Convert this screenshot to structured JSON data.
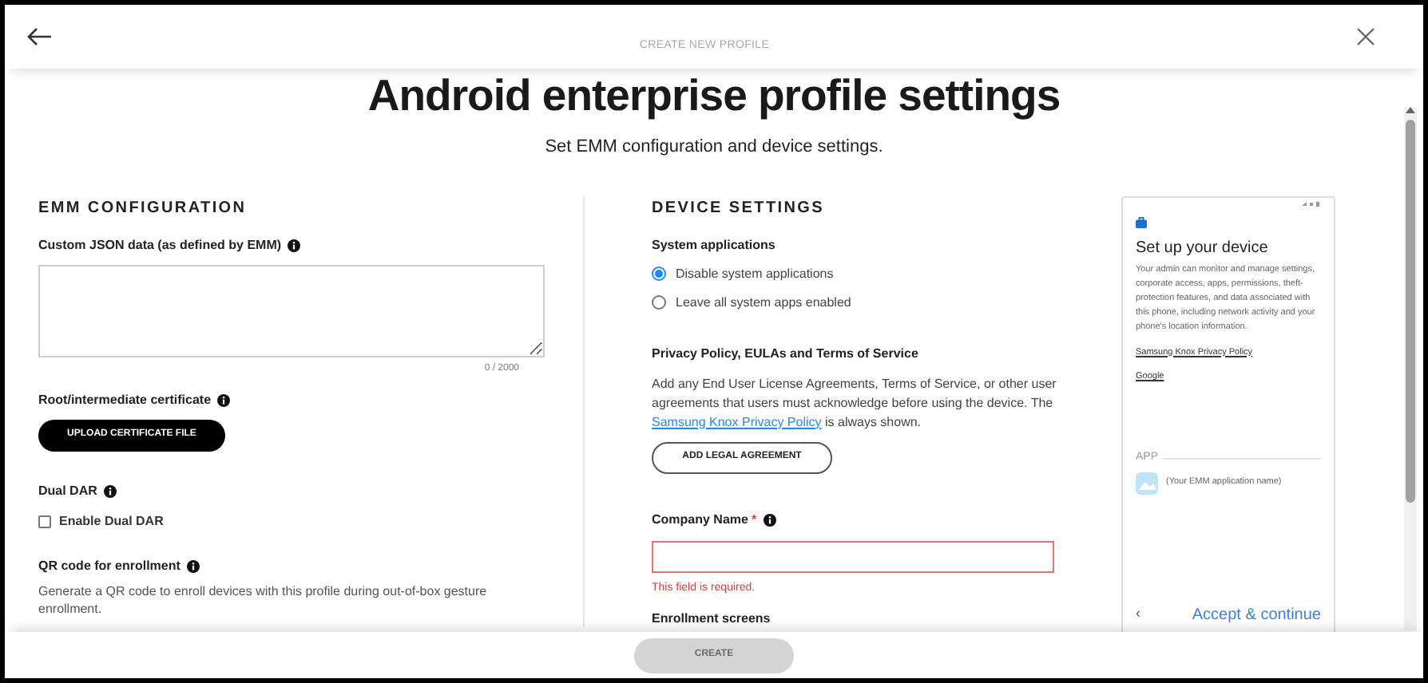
{
  "header": {
    "title": "CREATE NEW PROFILE"
  },
  "page": {
    "title": "Android enterprise profile settings",
    "subtitle": "Set EMM configuration and device settings."
  },
  "emm_configuration": {
    "heading": "EMM CONFIGURATION",
    "custom_json": {
      "label": "Custom JSON data (as defined by EMM)",
      "counter": "0 / 2000"
    },
    "certificate": {
      "label": "Root/intermediate certificate",
      "button": "UPLOAD CERTIFICATE FILE"
    },
    "dual_dar": {
      "label": "Dual DAR",
      "option": "Enable Dual DAR",
      "checked": false
    },
    "qr_code": {
      "label": "QR code for enrollment",
      "description": "Generate a QR code to enroll devices with this profile during out-of-box gesture enrollment."
    }
  },
  "device_settings": {
    "heading": "DEVICE SETTINGS",
    "system_applications": {
      "label": "System applications",
      "options": [
        {
          "label": "Disable system applications",
          "selected": true
        },
        {
          "label": "Leave all system apps enabled",
          "selected": false
        }
      ]
    },
    "privacy": {
      "label": "Privacy Policy, EULAs and Terms of Service",
      "text_before": "Add any End User License Agreements, Terms of Service, or other user agreements that users must acknowledge before using the device. The ",
      "link": "Samsung Knox Privacy Policy",
      "text_after": " is always shown.",
      "button": "ADD LEGAL AGREEMENT"
    },
    "company_name": {
      "label": "Company Name",
      "required_mark": "*",
      "error": "This field is required."
    },
    "enrollment_screens": {
      "label": "Enrollment screens"
    }
  },
  "preview": {
    "title": "Set up your device",
    "description": "Your admin can monitor and manage settings, corporate access, apps, permissions, theft-protection features, and data associated with this phone, including network activity and your phone's location information.",
    "links": [
      "Samsung Knox Privacy Policy",
      "Google"
    ],
    "app_section": "APP",
    "app_name": "(Your EMM application name)",
    "back": "‹",
    "action": "Accept & continue"
  },
  "footer": {
    "button": "CREATE",
    "disabled": true
  }
}
